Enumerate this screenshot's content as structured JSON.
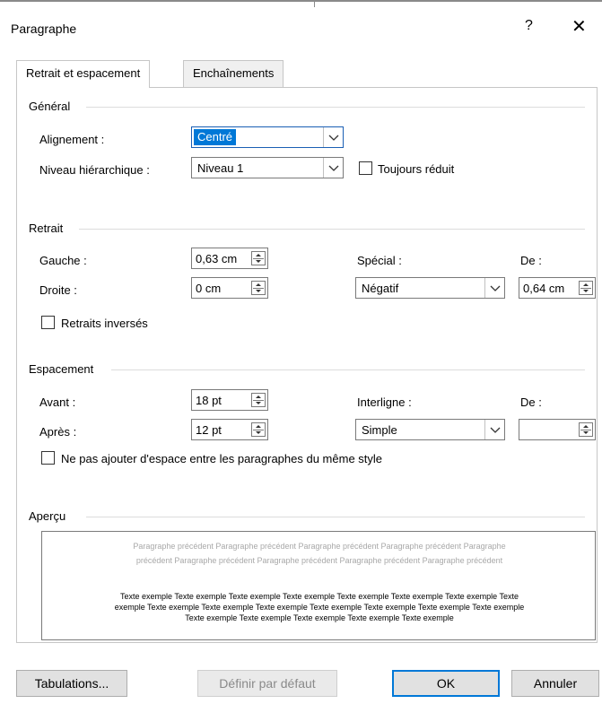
{
  "dialog": {
    "title": "Paragraphe",
    "help_glyph": "?",
    "close_glyph": "✕"
  },
  "tabs": [
    {
      "label": "Retrait et espacement",
      "active": true
    },
    {
      "label": "Enchaînements",
      "active": false
    }
  ],
  "general": {
    "section_label": "Général",
    "alignment": {
      "label": "Alignement :",
      "value": "Centré"
    },
    "outline_level": {
      "label": "Niveau hiérarchique :",
      "value": "Niveau 1"
    },
    "collapsed": {
      "label": "Toujours réduit",
      "checked": false
    }
  },
  "indentation": {
    "section_label": "Retrait",
    "left": {
      "label": "Gauche :",
      "value": "0,63 cm"
    },
    "right": {
      "label": "Droite :",
      "value": "0 cm"
    },
    "special": {
      "label": "Spécial :",
      "value": "Négatif"
    },
    "by": {
      "label": "De :",
      "value": "0,64 cm"
    },
    "mirror": {
      "label": "Retraits inversés",
      "checked": false
    }
  },
  "spacing": {
    "section_label": "Espacement",
    "before": {
      "label": "Avant :",
      "value": "18 pt"
    },
    "after": {
      "label": "Après :",
      "value": "12 pt"
    },
    "line_spacing": {
      "label": "Interligne :",
      "value": "Simple"
    },
    "at": {
      "label": "De :",
      "value": ""
    },
    "no_space_same_style": {
      "label": "Ne pas ajouter d'espace entre les paragraphes du même style",
      "checked": false
    }
  },
  "preview": {
    "section_label": "Aperçu",
    "previous_lines": [
      "Paragraphe   précédent   Paragraphe   précédent   Paragraphe   précédent   Paragraphe   précédent   Paragraphe",
      "précédent Paragraphe précédent Paragraphe précédent Paragraphe précédent Paragraphe précédent"
    ],
    "sample_lines": [
      "Texte exemple Texte exemple Texte exemple Texte exemple Texte exemple Texte exemple Texte exemple Texte",
      "exemple Texte exemple Texte exemple Texte exemple Texte exemple Texte exemple Texte exemple Texte exemple",
      "Texte exemple Texte exemple Texte exemple Texte exemple Texte exemple"
    ]
  },
  "buttons": {
    "tabs": "Tabulations...",
    "set_default": "Définir par défaut",
    "ok": "OK",
    "cancel": "Annuler"
  },
  "colors": {
    "accent": "#0078d7",
    "dialog_bg": "#ffffff",
    "button_bg": "#e1e1e1"
  }
}
